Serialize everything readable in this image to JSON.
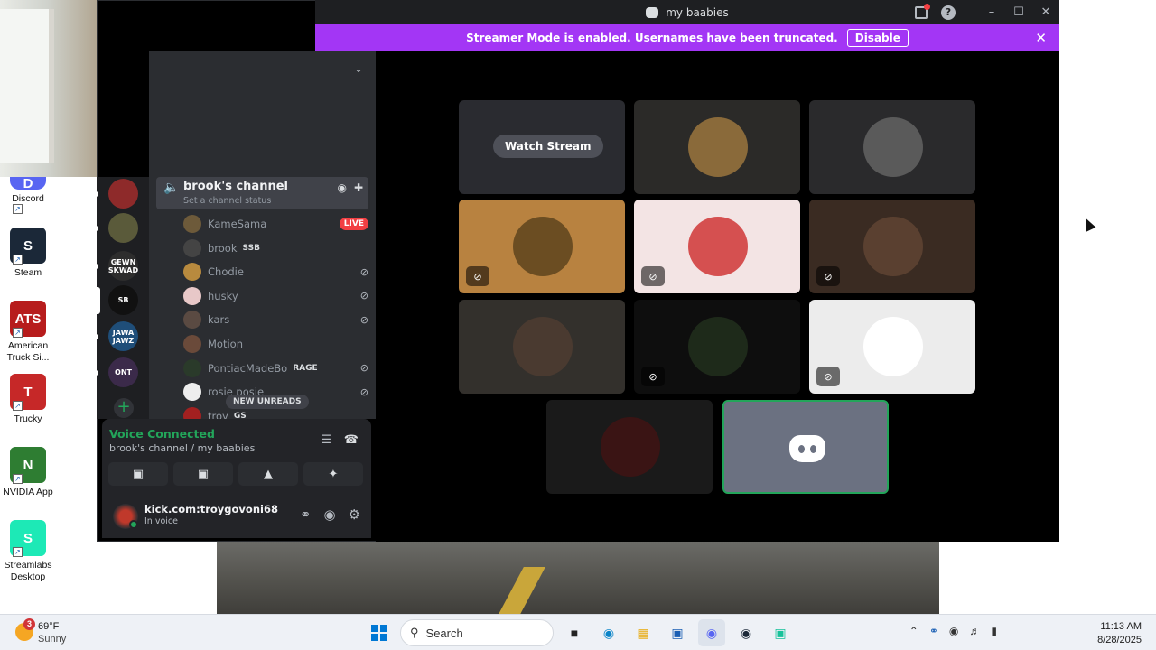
{
  "window": {
    "title": "my baabies",
    "controls": {
      "minimize": "–",
      "maximize": "☐",
      "close": "✕"
    }
  },
  "banner": {
    "message": "Streamer Mode is enabled. Usernames have been truncated.",
    "button": "Disable",
    "close": "✕"
  },
  "desktop_icons": [
    {
      "label": "Discord",
      "color": "#5865f2",
      "glyph": "D"
    },
    {
      "label": "Steam",
      "color": "#1b2838",
      "glyph": "S"
    },
    {
      "label": "American Truck Si...",
      "color": "#b71c1c",
      "glyph": "ATS"
    },
    {
      "label": "Trucky",
      "color": "#c62828",
      "glyph": "T"
    },
    {
      "label": "NVIDIA App",
      "color": "#2e7d32",
      "glyph": "N"
    },
    {
      "label": "Streamlabs Desktop",
      "color": "#1de9b6",
      "glyph": "S"
    }
  ],
  "guilds": [
    {
      "label": "",
      "color": "#8e2a2a"
    },
    {
      "label": "",
      "color": "#5a5a3a"
    },
    {
      "label": "GEWN SKWAD",
      "color": "#2d2d2d"
    },
    {
      "label": "SB",
      "color": "#111111"
    },
    {
      "label": "JAWA JAWZ",
      "color": "#1f4e79"
    },
    {
      "label": "ONT",
      "color": "#3b2a4a"
    }
  ],
  "channel": {
    "name": "brook's channel",
    "status_placeholder": "Set a channel status"
  },
  "voice_users": [
    {
      "name": "KameSama",
      "badge": "LIVE",
      "avatar": "#6d5a3a",
      "muted": false,
      "live": true
    },
    {
      "name": "brook",
      "tag": "SSB",
      "avatar": "#444444",
      "muted": false,
      "live": false
    },
    {
      "name": "Chodie",
      "avatar": "#b88a3e",
      "muted": true,
      "live": false
    },
    {
      "name": "husky",
      "avatar": "#e8c8c8",
      "muted": true,
      "live": false
    },
    {
      "name": "kars",
      "avatar": "#5a4a42",
      "muted": true,
      "live": false
    },
    {
      "name": "Motion",
      "avatar": "#6a4a3a",
      "muted": false,
      "live": false
    },
    {
      "name": "PontiacMadeBo",
      "tag": "RAGE",
      "avatar": "#2a3a2a",
      "muted": true,
      "live": false
    },
    {
      "name": "rosie posie",
      "avatar": "#eeeeee",
      "muted": true,
      "live": false
    },
    {
      "name": "troy",
      "tag": "GS",
      "avatar": "#a32020",
      "muted": false,
      "live": false
    }
  ],
  "new_unreads": "NEW UNREADS",
  "voice_panel": {
    "title": "Voice Connected",
    "subtitle": "brook's channel / my baabies"
  },
  "user_panel": {
    "name": "kick.com:troygovoni68",
    "status": "In voice"
  },
  "tiles": [
    {
      "kind": "stream",
      "bg": "#2a2b30",
      "button": "Watch Stream"
    },
    {
      "kind": "avatar",
      "bg": "#2b2a28",
      "pic": "#8a6a3a",
      "muted": false
    },
    {
      "kind": "avatar",
      "bg": "#2a2a2c",
      "pic": "#5a5a5a",
      "muted": false
    },
    {
      "kind": "avatar",
      "bg": "#b88240",
      "pic": "#6b4d22",
      "muted": true
    },
    {
      "kind": "avatar",
      "bg": "#f3e4e4",
      "pic": "#d55050",
      "muted": true
    },
    {
      "kind": "avatar",
      "bg": "#3a2b22",
      "pic": "#5a4030",
      "muted": true
    },
    {
      "kind": "avatar",
      "bg": "#33302c",
      "pic": "#4a3a30",
      "muted": false
    },
    {
      "kind": "avatar",
      "bg": "#0e0e0e",
      "pic": "#1e2a1a",
      "muted": true
    },
    {
      "kind": "avatar",
      "bg": "#ececec",
      "pic": "#ffffff",
      "muted": true
    },
    {
      "kind": "avatar",
      "bg": "#1a1a1a",
      "pic": "#3a1414",
      "muted": false
    },
    {
      "kind": "self",
      "bg": "#6b7181",
      "muted": false
    }
  ],
  "taskbar": {
    "weather_badge": "3",
    "temperature": "69°F",
    "condition": "Sunny",
    "search_placeholder": "Search",
    "time": "11:13 AM",
    "date": "8/28/2025"
  }
}
